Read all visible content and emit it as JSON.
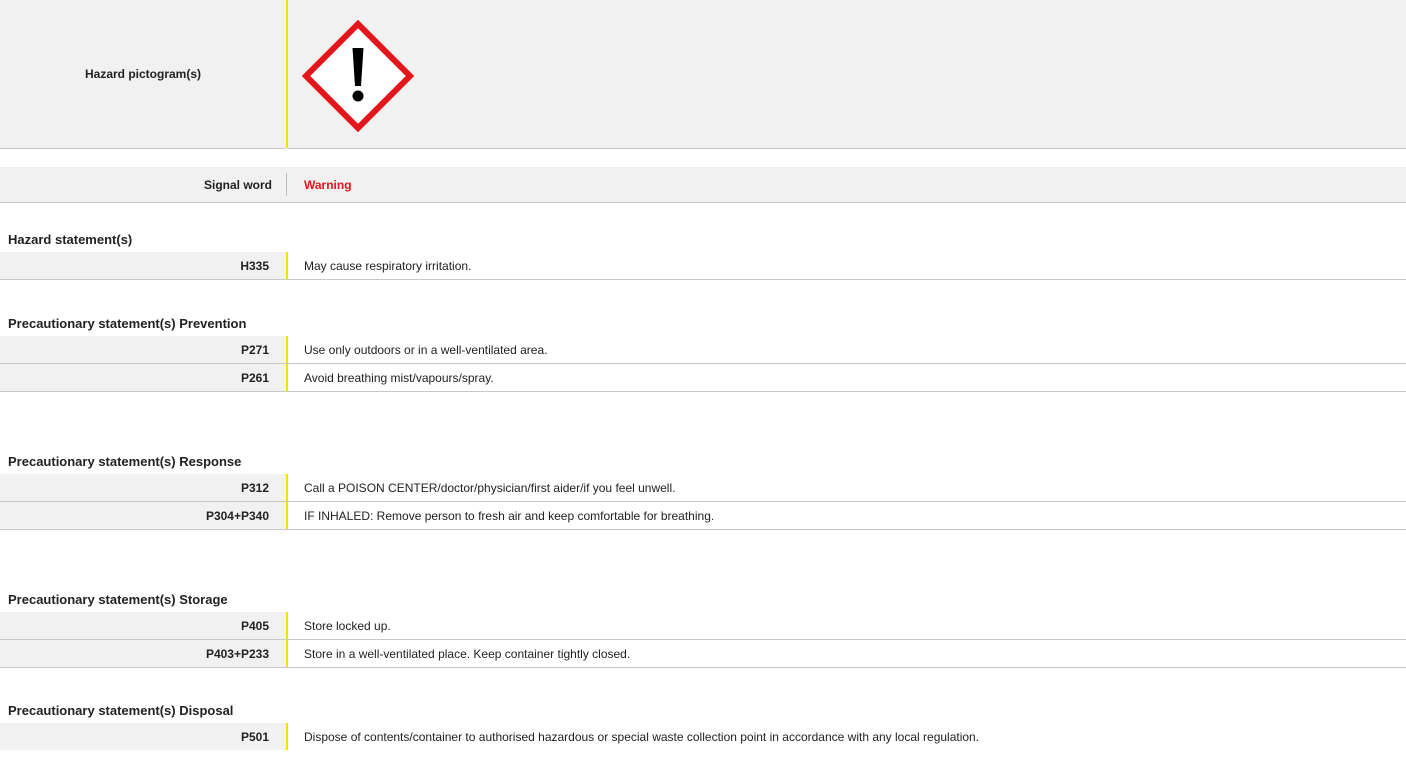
{
  "pictogram": {
    "label": "Hazard pictogram(s)",
    "icon": "exclamation-mark-diamond-icon",
    "border_color": "#e3161b"
  },
  "signal": {
    "label": "Signal word",
    "value": "Warning",
    "value_color": "#e3161b"
  },
  "sections": [
    {
      "title": "Hazard statement(s)",
      "rows": [
        {
          "code": "H335",
          "text": "May cause respiratory irritation."
        }
      ]
    },
    {
      "title": "Precautionary statement(s) Prevention",
      "rows": [
        {
          "code": "P271",
          "text": "Use only outdoors or in a well-ventilated area."
        },
        {
          "code": "P261",
          "text": "Avoid breathing mist/vapours/spray."
        }
      ]
    },
    {
      "title": "Precautionary statement(s) Response",
      "rows": [
        {
          "code": "P312",
          "text": "Call a POISON CENTER/doctor/physician/first aider/if you feel unwell."
        },
        {
          "code": "P304+P340",
          "text": "IF INHALED: Remove person to fresh air and keep comfortable for breathing."
        }
      ]
    },
    {
      "title": "Precautionary statement(s) Storage",
      "rows": [
        {
          "code": "P405",
          "text": "Store locked up."
        },
        {
          "code": "P403+P233",
          "text": "Store in a well-ventilated place. Keep container tightly closed."
        }
      ]
    },
    {
      "title": "Precautionary statement(s) Disposal",
      "rows": [
        {
          "code": "P501",
          "text": "Dispose of contents/container to authorised hazardous or special waste collection point in accordance with any local regulation."
        }
      ]
    }
  ]
}
